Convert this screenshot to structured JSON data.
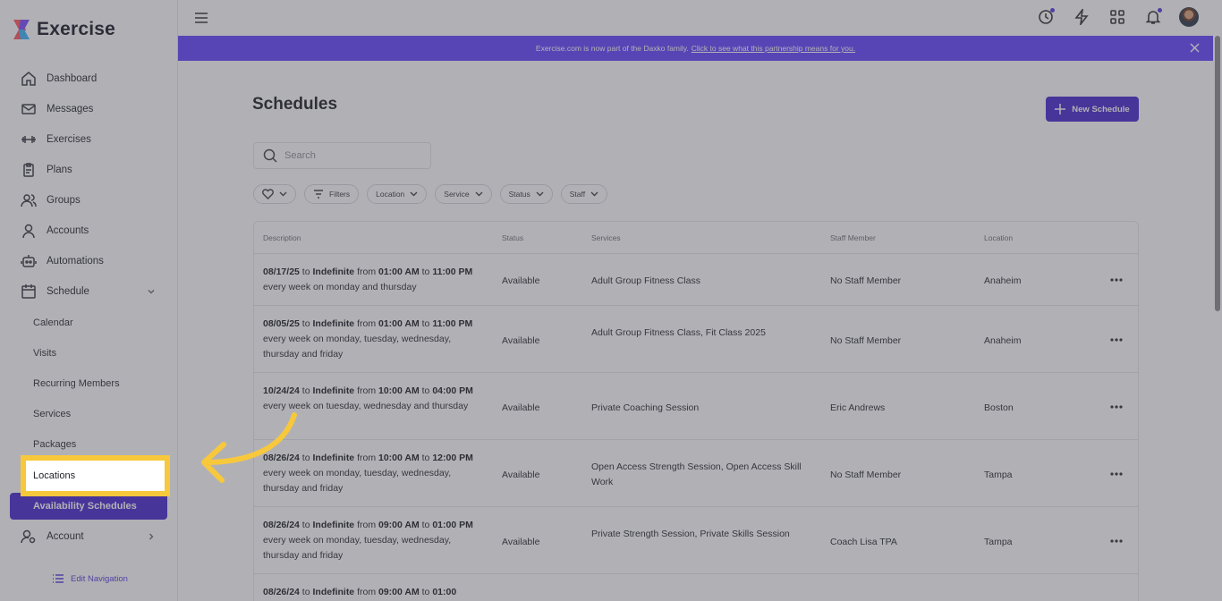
{
  "app": {
    "name": "Exercise"
  },
  "sidebar": {
    "items": [
      {
        "label": "Dashboard",
        "icon": "home-icon"
      },
      {
        "label": "Messages",
        "icon": "mail-icon"
      },
      {
        "label": "Exercises",
        "icon": "dumbbell-icon"
      },
      {
        "label": "Plans",
        "icon": "clipboard-icon"
      },
      {
        "label": "Groups",
        "icon": "users-icon"
      },
      {
        "label": "Accounts",
        "icon": "user-icon"
      },
      {
        "label": "Automations",
        "icon": "robot-icon"
      },
      {
        "label": "Schedule",
        "icon": "calendar-icon"
      }
    ],
    "schedule_sub": [
      "Calendar",
      "Visits",
      "Recurring Members",
      "Services",
      "Packages",
      "Locations",
      "Availability Schedules"
    ],
    "active_sub": "Availability Schedules",
    "highlighted": "Locations",
    "account_label": "Account",
    "edit_nav": "Edit Navigation"
  },
  "banner": {
    "text": "Exercise.com is now part of the Daxko family.",
    "link": "Click to see what this partnership means for you."
  },
  "page": {
    "title": "Schedules",
    "new_button": "New Schedule",
    "search_placeholder": "Search",
    "filters": [
      "Filters",
      "Location",
      "Service",
      "Status",
      "Staff"
    ]
  },
  "table": {
    "headers": [
      "Description",
      "Status",
      "Services",
      "Staff Member",
      "Location"
    ],
    "rows": [
      {
        "start": "08/17/25",
        "end": "Indefinite",
        "from": "01:00 AM",
        "to": "11:00 PM",
        "days": "every week on monday and thursday",
        "status": "Available",
        "services": "Adult Group Fitness Class",
        "staff": "No Staff Member",
        "location": "Anaheim"
      },
      {
        "start": "08/05/25",
        "end": "Indefinite",
        "from": "01:00 AM",
        "to": "11:00 PM",
        "days": "every week on monday, tuesday, wednesday, thursday and friday",
        "status": "Available",
        "services": "Adult Group Fitness Class, Fit Class 2025",
        "staff": "No Staff Member",
        "location": "Anaheim"
      },
      {
        "start": "10/24/24",
        "end": "Indefinite",
        "from": "10:00 AM",
        "to": "04:00 PM",
        "days": "every week on tuesday, wednesday and thursday",
        "status": "Available",
        "services": "Private Coaching Session",
        "staff": "Eric Andrews",
        "location": "Boston"
      },
      {
        "start": "08/26/24",
        "end": "Indefinite",
        "from": "10:00 AM",
        "to": "12:00 PM",
        "days": "every week on monday, tuesday, wednesday, thursday and friday",
        "status": "Available",
        "services": "Open Access Strength Session, Open Access Skill Work",
        "staff": "No Staff Member",
        "location": "Tampa"
      },
      {
        "start": "08/26/24",
        "end": "Indefinite",
        "from": "09:00 AM",
        "to": "01:00 PM",
        "days": "every week on monday, tuesday, wednesday, thursday and friday",
        "status": "Available",
        "services": "Private Strength Session, Private Skills Session",
        "staff": "Coach Lisa TPA",
        "location": "Tampa"
      },
      {
        "start": "08/26/24",
        "end": "Indefinite",
        "from": "09:00 AM",
        "to": "01:00",
        "days": "",
        "status": "",
        "services": "",
        "staff": "",
        "location": ""
      }
    ]
  },
  "words": {
    "to": "to",
    "from": "from"
  },
  "colors": {
    "accent": "#4a2ad0",
    "banner": "#6746ff",
    "highlight": "#f7c83b"
  }
}
